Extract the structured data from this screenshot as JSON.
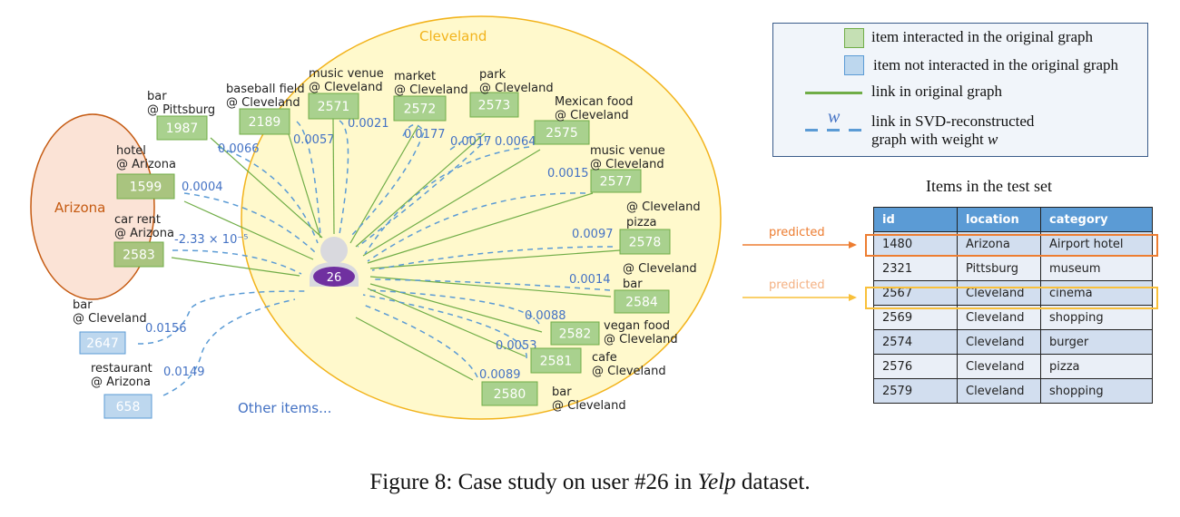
{
  "colors": {
    "interacted_fill": "#a9d18e",
    "interacted_border": "#70ad47",
    "arizona_item_fill": "#a9c47f",
    "not_interacted_fill": "#bdd7ee",
    "not_interacted_border": "#5b9bd5",
    "link_original": "#70ad47",
    "link_svd": "#5b9bd5",
    "weight_text": "#4472c4",
    "cleveland_region_fill": "#fff9cc",
    "cleveland_region_border": "#f2b31b",
    "cleveland_label": "#f2b31b",
    "arizona_region_fill": "#fbe3d6",
    "arizona_region_border": "#c55a11",
    "arizona_label": "#c55a11",
    "user_badge": "#7030a0",
    "user_silhouette": "#d9d9de",
    "predicted_orange": "#ed7d31",
    "predicted_yellow": "#f4b183",
    "predicted_yellow_box": "#f9c03a"
  },
  "regions": {
    "cleveland": "Cleveland",
    "arizona": "Arizona"
  },
  "user": {
    "id": "26"
  },
  "items": [
    {
      "id": "1987",
      "name": "bar",
      "loc": "@ Pittsburg",
      "interacted": true,
      "weight": "0.0066"
    },
    {
      "id": "2189",
      "name": "baseball field",
      "loc": "@ Cleveland",
      "interacted": true,
      "weight": "0.0057"
    },
    {
      "id": "2571",
      "name": "music venue",
      "loc": "@ Cleveland",
      "interacted": true,
      "weight": "0.0021"
    },
    {
      "id": "2572",
      "name": "market",
      "loc": "@ Cleveland",
      "interacted": true,
      "weight": "0.0177"
    },
    {
      "id": "2573",
      "name": "park",
      "loc": "@ Cleveland",
      "interacted": true,
      "weight": "0.0017"
    },
    {
      "id": "2575",
      "name": "Mexican food",
      "loc": "@ Cleveland",
      "interacted": true,
      "weight": "0.0064"
    },
    {
      "id": "2577",
      "name": "music venue",
      "loc": "@ Cleveland",
      "interacted": true,
      "weight": "0.0015"
    },
    {
      "id": "2578",
      "name": "pizza",
      "loc": "@ Cleveland",
      "interacted": true,
      "weight": "0.0097"
    },
    {
      "id": "2584",
      "name": "bar",
      "loc": "@ Cleveland",
      "interacted": true,
      "weight": "0.0014"
    },
    {
      "id": "2582",
      "name": "vegan food",
      "loc": "@ Cleveland",
      "interacted": true,
      "weight": "0.0088"
    },
    {
      "id": "2581",
      "name": "cafe",
      "loc": "@ Cleveland",
      "interacted": true,
      "weight": "0.0053"
    },
    {
      "id": "2580",
      "name": "bar",
      "loc": "@ Cleveland",
      "interacted": true,
      "weight": "0.0089"
    },
    {
      "id": "1599",
      "name": "hotel",
      "loc": "@ Arizona",
      "interacted": true,
      "weight": "0.0004"
    },
    {
      "id": "2583",
      "name": "car rent",
      "loc": "@ Arizona",
      "interacted": true,
      "weight": "-2.33 × 10⁻⁵"
    },
    {
      "id": "2647",
      "name": "bar",
      "loc": "@ Cleveland",
      "interacted": false,
      "weight": "0.0156"
    },
    {
      "id": "658",
      "name": "restaurant",
      "loc": "@ Arizona",
      "interacted": false,
      "weight": "0.0149"
    }
  ],
  "other_items_label": "Other items...",
  "legend": {
    "interacted": "item interacted in the original graph",
    "not_interacted": "item not interacted in the original graph",
    "original_link": "link in original graph",
    "svd_link_line1": "link in SVD-reconstructed",
    "svd_link_line2": "graph with weight",
    "weight_symbol": "w"
  },
  "test_set": {
    "title": "Items in the test set",
    "columns": [
      "id",
      "location",
      "category"
    ],
    "rows": [
      [
        "1480",
        "Arizona",
        "Airport hotel"
      ],
      [
        "2321",
        "Pittsburg",
        "museum"
      ],
      [
        "2567",
        "Cleveland",
        "cinema"
      ],
      [
        "2569",
        "Cleveland",
        "shopping"
      ],
      [
        "2574",
        "Cleveland",
        "burger"
      ],
      [
        "2576",
        "Cleveland",
        "pizza"
      ],
      [
        "2579",
        "Cleveland",
        "shopping"
      ]
    ],
    "predicted_label": "predicted",
    "predicted_rows": [
      "1480",
      "2567"
    ]
  },
  "caption": {
    "prefix": "Figure 8: Case study on user #26 in ",
    "dataset": "Yelp",
    "suffix": " dataset."
  }
}
